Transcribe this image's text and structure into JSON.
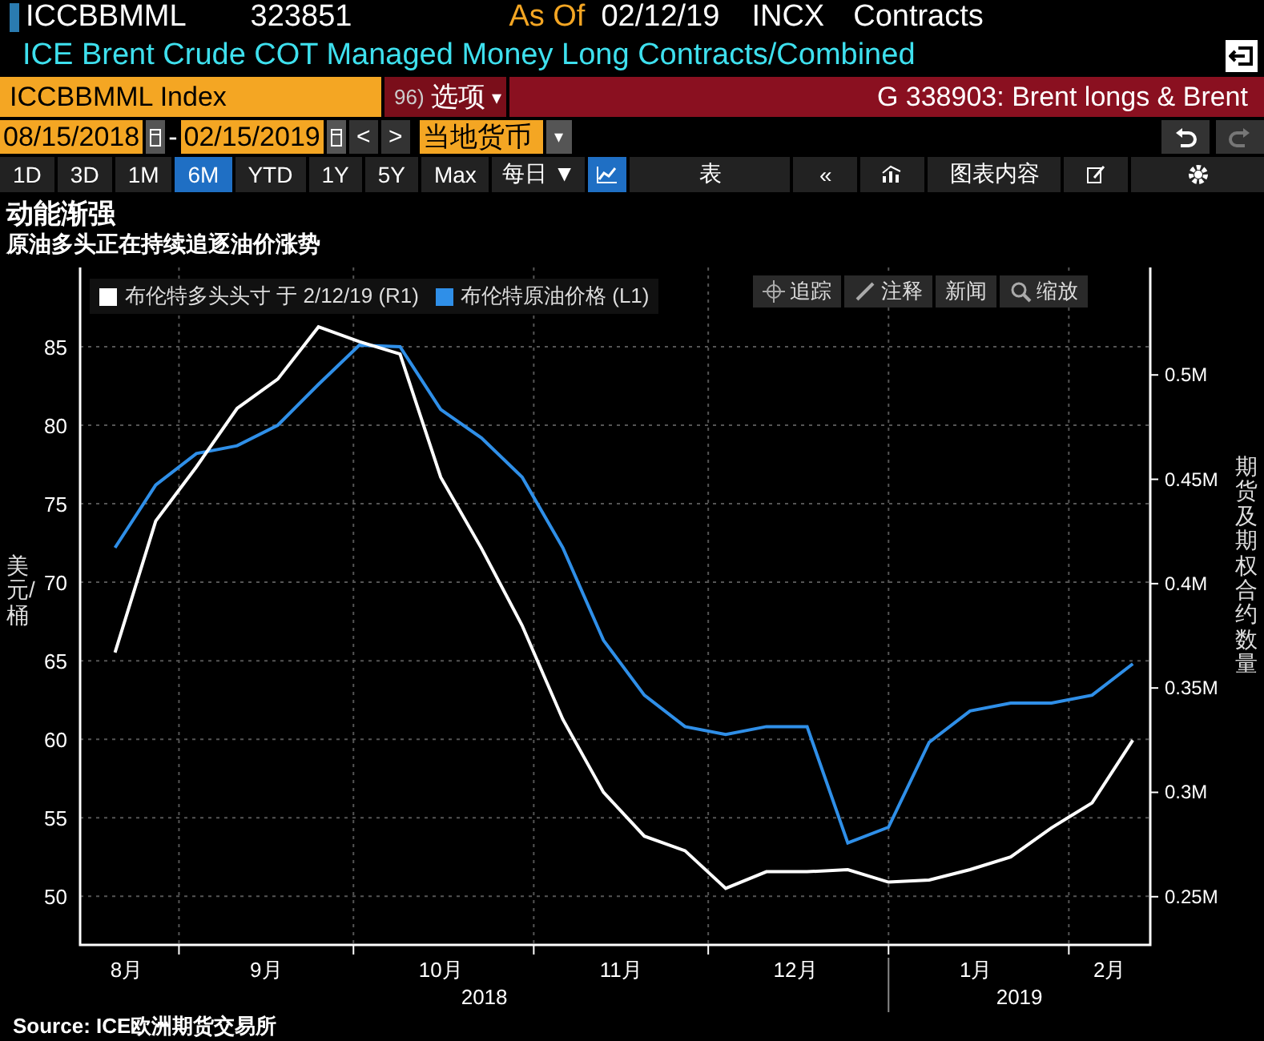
{
  "header": {
    "ticker": "ICCBBMML",
    "number": "323851",
    "as_of_label": "As Of",
    "as_of_date": "02/12/19",
    "source_code": "INCX",
    "unit": "Contracts",
    "description": "ICE Brent Crude COT Managed Money Long Contracts/Combined"
  },
  "command_bar": {
    "security": "ICCBBMML Index",
    "options_number": "96)",
    "options_label": "选项",
    "options_caret": "▾",
    "chart_title": "G 338903: Brent longs & Brent"
  },
  "date_bar": {
    "start": "08/15/2018",
    "separator": "-",
    "end": "02/15/2019",
    "prev": "<",
    "next": ">",
    "currency": "当地货币",
    "currency_caret": "▾"
  },
  "toolbar": {
    "ranges": [
      {
        "label": "1D",
        "selected": false
      },
      {
        "label": "3D",
        "selected": false
      },
      {
        "label": "1M",
        "selected": false
      },
      {
        "label": "6M",
        "selected": true
      },
      {
        "label": "YTD",
        "selected": false
      },
      {
        "label": "1Y",
        "selected": false
      },
      {
        "label": "5Y",
        "selected": false
      },
      {
        "label": "Max",
        "selected": false
      }
    ],
    "frequency": "每日 ▼",
    "views": [
      {
        "kind": "chart",
        "selected": true
      },
      {
        "kind": "table",
        "label": "表",
        "selected": false
      }
    ],
    "collapse": "«",
    "chart_contents": "图表内容"
  },
  "title": "动能渐强",
  "subtitle": "原油多头正在持续追逐油价涨势",
  "chart_tools": [
    {
      "kind": "crosshair",
      "label": "追踪"
    },
    {
      "kind": "pen",
      "label": "注释"
    },
    {
      "kind": "none",
      "label": "新闻"
    },
    {
      "kind": "magnifier",
      "label": "缩放"
    }
  ],
  "price_chart": {
    "year_labels": [
      "2018",
      "2019"
    ],
    "chart_data": {
      "type": "line",
      "grid": true,
      "ylabel": "美元/桶",
      "xlim": [
        "2018-08-15",
        "2019-02-15"
      ],
      "ylim": [
        46.9,
        90.05
      ],
      "yticks": [
        50,
        55,
        60,
        65,
        70,
        75,
        80,
        85
      ],
      "xticks": [
        {
          "value": "2018-08-23",
          "label": "8月"
        },
        {
          "value": "2018-09-16",
          "label": "9月"
        },
        {
          "value": "2018-10-16",
          "label": "10月"
        },
        {
          "value": "2018-11-16",
          "label": "11月"
        },
        {
          "value": "2018-12-16",
          "label": "12月"
        },
        {
          "value": "2019-01-16",
          "label": "1月"
        },
        {
          "value": "2019-02-08",
          "label": "2月"
        }
      ],
      "x": [
        "2018-08-21",
        "2018-08-28",
        "2018-09-04",
        "2018-09-11",
        "2018-09-18",
        "2018-09-25",
        "2018-10-02",
        "2018-10-09",
        "2018-10-16",
        "2018-10-23",
        "2018-10-30",
        "2018-11-06",
        "2018-11-13",
        "2018-11-20",
        "2018-11-27",
        "2018-12-04",
        "2018-12-11",
        "2018-12-18",
        "2018-12-25",
        "2019-01-01",
        "2019-01-08",
        "2019-01-15",
        "2019-01-22",
        "2019-01-29",
        "2019-02-05",
        "2019-02-12"
      ],
      "series": [
        {
          "name": "布伦特原油价格 (L1)",
          "color": "#2f8fe8",
          "values": [
            72.2,
            76.2,
            78.2,
            78.7,
            80.0,
            82.6,
            85.1,
            85.0,
            81.0,
            79.2,
            76.7,
            72.2,
            66.3,
            62.8,
            60.8,
            60.3,
            60.8,
            60.8,
            53.4,
            54.4,
            59.8,
            61.8,
            62.3,
            62.3,
            62.8,
            64.8
          ]
        }
      ]
    }
  },
  "longs_chart": {
    "chart_data": {
      "type": "line",
      "ylabel": "期货及期权合约数量",
      "xlim": [
        "2018-08-15",
        "2019-02-15"
      ],
      "ylim": [
        226900,
        551500
      ],
      "yticks": [
        {
          "value": 250000,
          "label": "0.25M"
        },
        {
          "value": 300000,
          "label": "0.3M"
        },
        {
          "value": 350000,
          "label": "0.35M"
        },
        {
          "value": 400000,
          "label": "0.4M"
        },
        {
          "value": 450000,
          "label": "0.45M"
        },
        {
          "value": 500000,
          "label": "0.5M"
        }
      ],
      "x": [
        "2018-08-21",
        "2018-08-28",
        "2018-09-04",
        "2018-09-11",
        "2018-09-18",
        "2018-09-25",
        "2018-10-02",
        "2018-10-09",
        "2018-10-16",
        "2018-10-23",
        "2018-10-30",
        "2018-11-06",
        "2018-11-13",
        "2018-11-20",
        "2018-11-27",
        "2018-12-04",
        "2018-12-11",
        "2018-12-18",
        "2018-12-25",
        "2019-01-01",
        "2019-01-08",
        "2019-01-15",
        "2019-01-22",
        "2019-01-29",
        "2019-02-05",
        "2019-02-12"
      ],
      "series": [
        {
          "name": "布伦特多头头寸 于 2/12/19 (R1)",
          "color": "#ffffff",
          "values": [
            367000,
            430000,
            456000,
            484000,
            498000,
            523000,
            516000,
            510000,
            451000,
            417000,
            380000,
            335000,
            300000,
            279000,
            272000,
            254000,
            262000,
            262000,
            263000,
            257000,
            258000,
            263000,
            269000,
            283000,
            295000,
            325000
          ]
        }
      ]
    }
  },
  "source": "Source: ICE欧洲期货交易所"
}
